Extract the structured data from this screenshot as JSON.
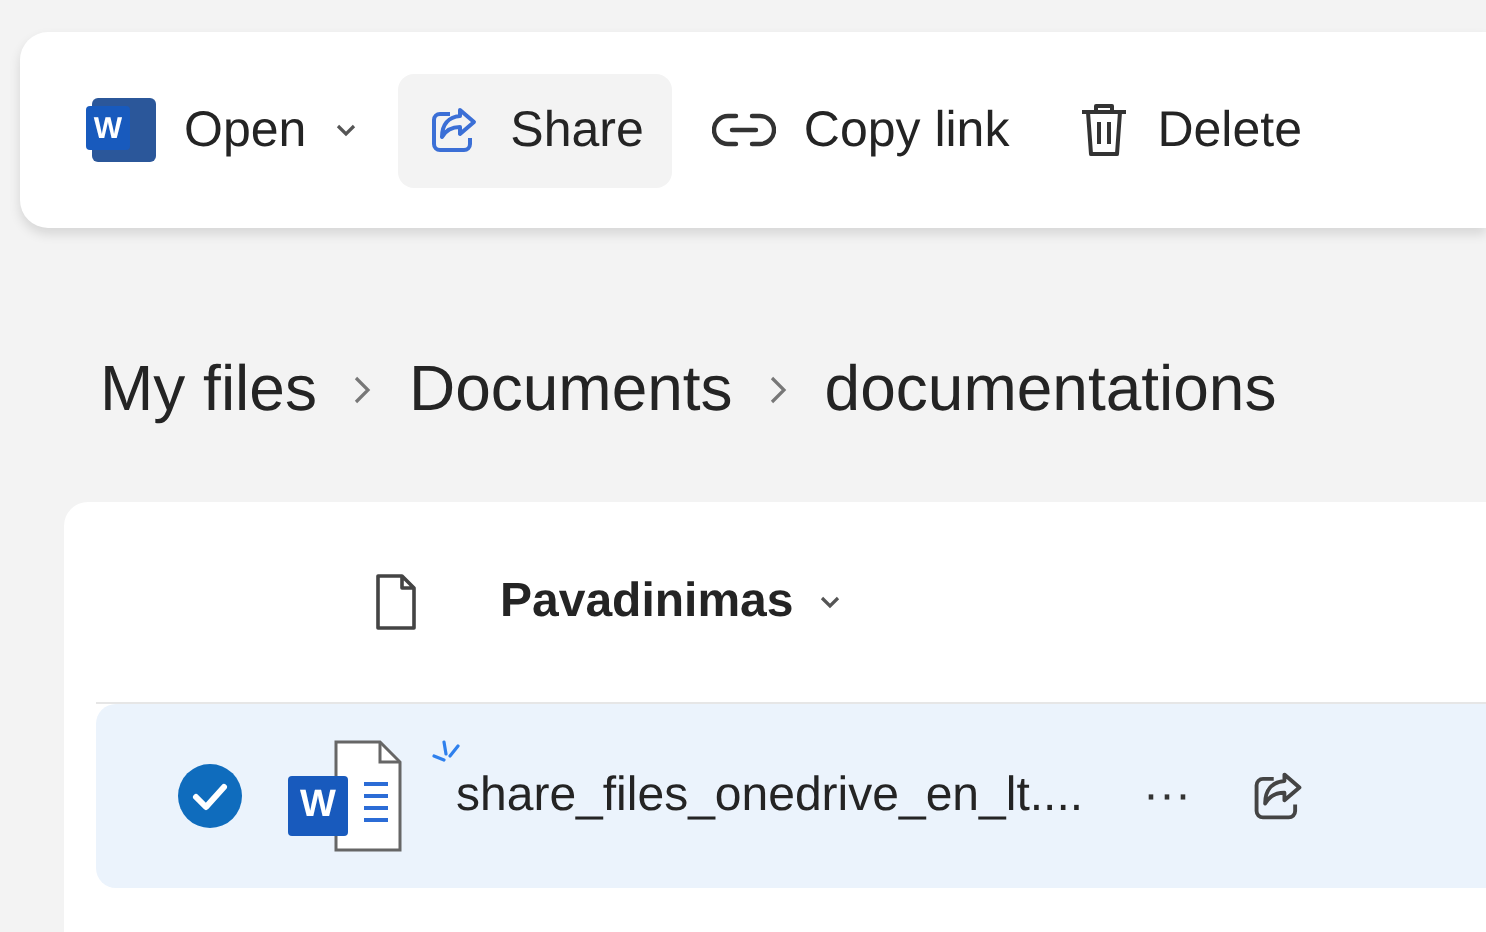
{
  "toolbar": {
    "buttons": [
      {
        "kind": "open",
        "label": "Open",
        "icon_letter": "W",
        "hovered": false
      },
      {
        "kind": "share",
        "label": "Share",
        "hovered": true
      },
      {
        "kind": "copy_link",
        "label": "Copy link",
        "hovered": false
      },
      {
        "kind": "delete",
        "label": "Delete",
        "hovered": false
      }
    ]
  },
  "breadcrumb": [
    "My files",
    "Documents",
    "documentations"
  ],
  "table": {
    "columns": [
      {
        "label": "Pavadinimas"
      }
    ],
    "rows": [
      {
        "name": "share_files_onedrive_en_lt....",
        "icon_letter": "W",
        "selected": true,
        "more": "···"
      }
    ]
  }
}
